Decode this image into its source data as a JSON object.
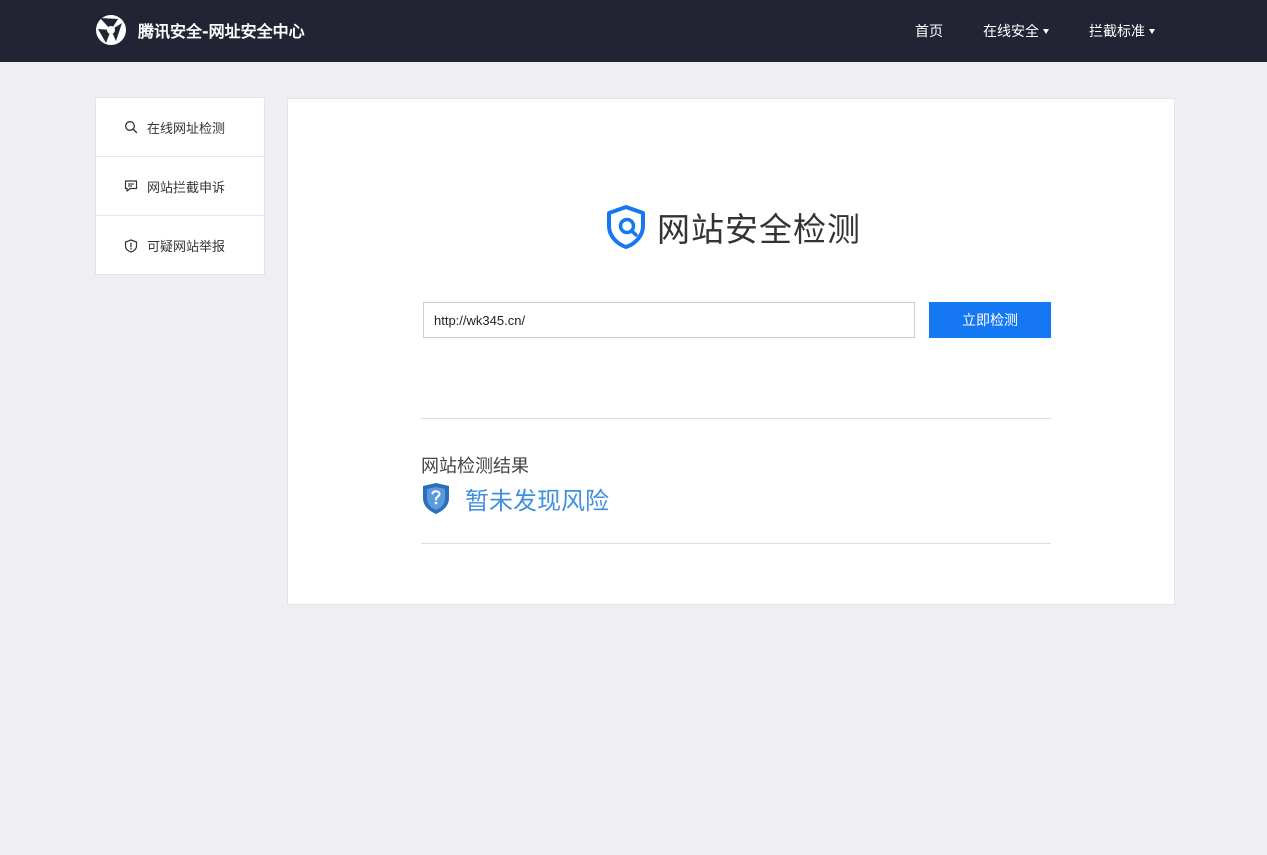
{
  "header": {
    "brand_title": "腾讯安全-网址安全中心",
    "nav": [
      {
        "label": "首页",
        "icon": ""
      },
      {
        "label": "在线安全",
        "icon": "caret-down-icon"
      },
      {
        "label": "拦截标准",
        "icon": "caret-down-icon"
      }
    ]
  },
  "sidebar": {
    "items": [
      {
        "label": "在线网址检测",
        "icon": "search-icon"
      },
      {
        "label": "网站拦截申诉",
        "icon": "chat-icon"
      },
      {
        "label": "可疑网站举报",
        "icon": "shield-alert-icon"
      }
    ]
  },
  "main": {
    "title": "网站安全检测",
    "url_input": {
      "value": "http://wk345.cn/",
      "placeholder": ""
    },
    "check_button": "立即检测",
    "result": {
      "label": "网站检测结果",
      "status": "暂未发现风险",
      "status_color": "#3f8fdf",
      "icon": "shield-question-icon"
    }
  },
  "colors": {
    "topbar": "#222433",
    "accent": "#1677f2",
    "background": "#efeff3"
  }
}
